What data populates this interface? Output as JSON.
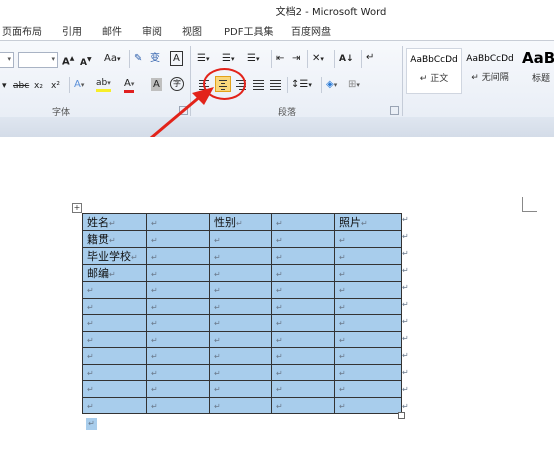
{
  "window": {
    "title": "文档2 - Microsoft Word"
  },
  "tabs": [
    "页面布局",
    "引用",
    "邮件",
    "审阅",
    "视图",
    "PDF工具集",
    "百度网盘"
  ],
  "ribbon": {
    "font_group_label": "字体",
    "paragraph_group_label": "段落",
    "font_size_value": "",
    "grow_font": "A",
    "shrink_font": "A",
    "change_case": "Aa",
    "phonetic_guide": "变",
    "char_border": "A",
    "strikethrough": "abc",
    "subscript": "x₂",
    "superscript": "x²",
    "text_effects": "A",
    "highlight": "ab",
    "font_color": "A",
    "char_shading": "A",
    "enclose_char": "字",
    "sort": "A↓",
    "show_marks": "↵",
    "center_tooltip_target": "居中",
    "styles": [
      {
        "preview": "AaBbCcDd",
        "name": "↵ 正文"
      },
      {
        "preview": "AaBbCcDd",
        "name": "↵ 无间隔"
      },
      {
        "preview": "AaB",
        "name": "标题"
      }
    ]
  },
  "colors": {
    "accent": "#e2231a",
    "cell_selection": "#a8cdec",
    "active_button": "#f9d77c"
  },
  "table": {
    "rows": [
      [
        "姓名",
        "",
        "性别",
        "",
        "照片"
      ],
      [
        "籍贯",
        "",
        "",
        "",
        ""
      ],
      [
        "毕业学校",
        "",
        "",
        "",
        ""
      ],
      [
        "邮编",
        "",
        "",
        "",
        ""
      ],
      [
        "",
        "",
        "",
        "",
        ""
      ],
      [
        "",
        "",
        "",
        "",
        ""
      ],
      [
        "",
        "",
        "",
        "",
        ""
      ],
      [
        "",
        "",
        "",
        "",
        ""
      ],
      [
        "",
        "",
        "",
        "",
        ""
      ],
      [
        "",
        "",
        "",
        "",
        ""
      ],
      [
        "",
        "",
        "",
        "",
        ""
      ],
      [
        "",
        "",
        "",
        "",
        ""
      ]
    ],
    "paragraph_mark": "↵"
  }
}
